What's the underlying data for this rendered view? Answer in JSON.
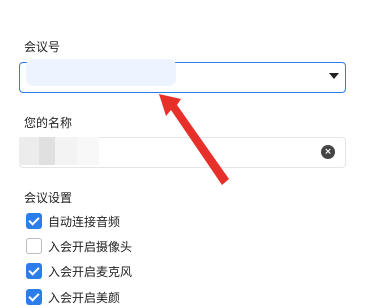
{
  "meeting": {
    "label": "会议号",
    "value": ""
  },
  "name": {
    "label": "您的名称",
    "value": ""
  },
  "settings": {
    "label": "会议设置",
    "options": [
      {
        "label": "自动连接音频",
        "checked": true
      },
      {
        "label": "入会开启摄像头",
        "checked": false
      },
      {
        "label": "入会开启麦克风",
        "checked": true
      },
      {
        "label": "入会开启美颜",
        "checked": true
      }
    ]
  },
  "icons": {
    "dropdown": "chevron-down-icon",
    "clear": "clear-icon",
    "annotation": "red-arrow-annotation"
  },
  "colors": {
    "accent": "#2b7de9",
    "annotation": "#e8302a"
  }
}
